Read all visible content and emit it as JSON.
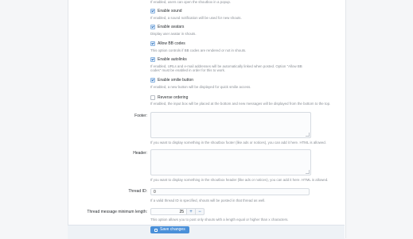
{
  "options": [
    {
      "label": "Enable sound",
      "desc": "If enabled, a sound notification will be used for new shouts.",
      "checked": true
    },
    {
      "label": "Enable avatars",
      "desc": "Display user avatar in shouts.",
      "checked": true
    },
    {
      "label": "Allow BB codes",
      "desc": "This option controls if BB codes are rendered or not in shouts.",
      "checked": true
    },
    {
      "label": "Enable autolinks",
      "desc": "If enabled, URLs and e-mail addresses will be automatically linked when posted. Option \"Allow BB codes\" must be enabled in order for this to work.",
      "checked": true
    },
    {
      "label": "Enable smilie button",
      "desc": "If enabled, a new button will be displayed for quick smilie access.",
      "checked": true
    },
    {
      "label": "Reverse ordering",
      "desc": "If enabled, the input box will be placed at the bottom and new messages will be displayed from the bottom to the top.",
      "checked": false
    }
  ],
  "top_desc": "If enabled, users can open the shoutbox in a popup.",
  "footer": {
    "label": "Footer:",
    "desc": "If you want to display something in the shoutbox footer (like ads or notices), you can add it here. HTML is allowed."
  },
  "header": {
    "label": "Header:",
    "desc": "If you want to display something in the shoutbox header (like ads or notices), you can add it here. HTML is allowed."
  },
  "thread_id": {
    "label": "Thread ID:",
    "value": "0",
    "desc": "If a valid thread ID is specified, shouts will be posted in that thread as well."
  },
  "min_length": {
    "label": "Thread message minimum length:",
    "value": "25",
    "desc": "This option allows you to post only shouts with a length equal or higher than x characters."
  },
  "stepper": {
    "plus": "+",
    "minus": "−"
  },
  "save_label": "Save changes"
}
